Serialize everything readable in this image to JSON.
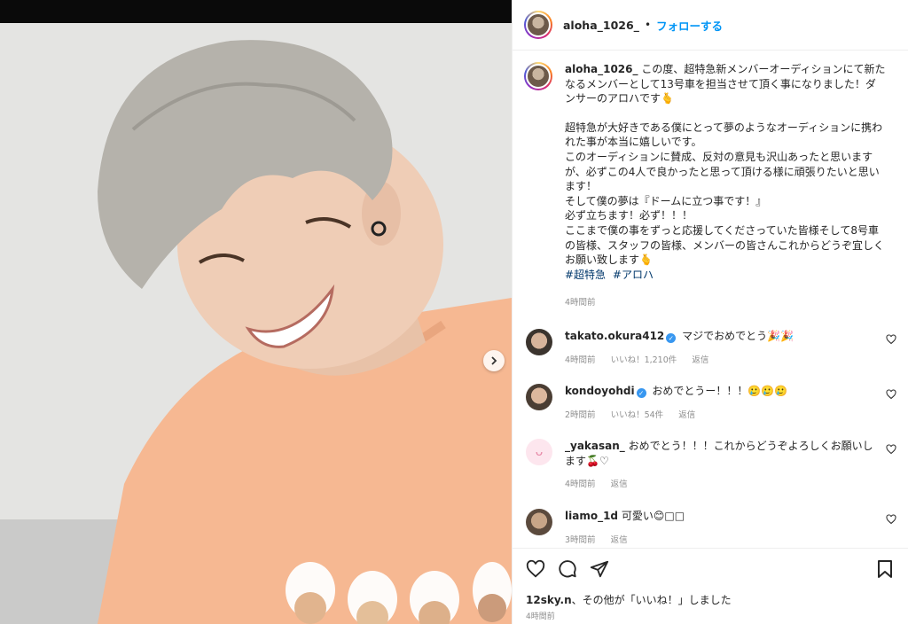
{
  "post": {
    "username": "aloha_1026_",
    "separator": "•",
    "follow_label": "フォローする",
    "next_label": ""
  },
  "caption": {
    "username": "aloha_1026_",
    "line1": "この度、超特急新メンバーオーディションにて新たなるメンバーとして13号車を担当させて頂く事になりました！ダンサーのアロハです🫰",
    "para2": "超特急が大好きである僕にとって夢のようなオーディションに携われた事が本当に嬉しいです。",
    "para3": "このオーディションに賛成、反対の意見も沢山あったと思いますが、必ずこの4人で良かったと思って頂ける様に頑張りたいと思います！",
    "para4": "そして僕の夢は『ドームに立つ事です！』",
    "para5": "必ず立ちます！必ず！！！",
    "para6": "ここまで僕の事をずっと応援してくださっていた皆様そして8号車の皆様、スタッフの皆様、メンバーの皆さんこれからどうぞ宜しくお願い致します🫰",
    "hashtags": [
      "#超特急",
      "#アロハ"
    ],
    "time": "4時間前"
  },
  "comments": [
    {
      "username": "takato.okura412",
      "verified": true,
      "text": "マジでおめでとう🎉🎉",
      "time": "4時間前",
      "likes": "いいね！1,210件",
      "reply": "返信"
    },
    {
      "username": "kondoyohdi",
      "verified": true,
      "text": "おめでとうー！！！🥲🥲🥲",
      "time": "2時間前",
      "likes": "いいね！54件",
      "reply": "返信"
    },
    {
      "username": "_yakasan_",
      "verified": false,
      "text": "おめでとう！！！これからどうぞよろしくお願いします🍒♡",
      "time": "4時間前",
      "likes": "",
      "reply": "返信"
    },
    {
      "username": "liamo_1d",
      "verified": false,
      "text": "可愛い😊□□",
      "time": "3時間前",
      "likes": "",
      "reply": "返信"
    }
  ],
  "footer": {
    "likes_user": "12sky.n",
    "likes_suffix": "、その他が「いいね！」しました",
    "time": "4時間前"
  },
  "colors": {
    "accent": "#0095f6",
    "shirt": "#f6b892",
    "hair": "#b5b2ab"
  }
}
